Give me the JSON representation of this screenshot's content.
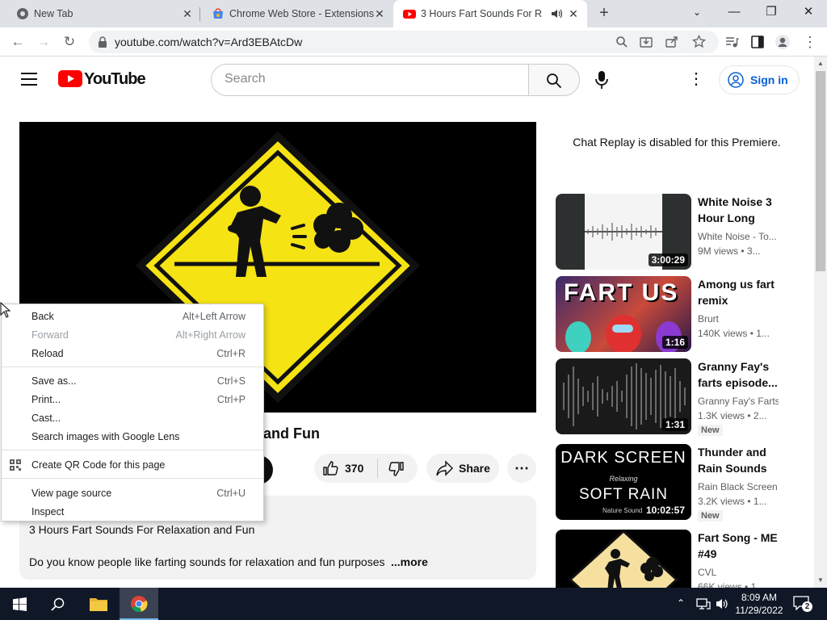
{
  "tabs": [
    {
      "title": "New Tab",
      "icon": "chrome-icon"
    },
    {
      "title": "Chrome Web Store - Extensions",
      "icon": "web-store-icon"
    },
    {
      "title": "3 Hours Fart Sounds For Rela",
      "icon": "youtube-icon",
      "active": true
    }
  ],
  "toolbar": {
    "url": "youtube.com/watch?v=Ard3EBAtcDw"
  },
  "yt": {
    "logo_text": "YouTube",
    "search_placeholder": "Search",
    "sign_in": "Sign in",
    "video_title_visible": "and Fun",
    "likes": "370",
    "share": "Share",
    "desc_title": "3 Hours Fart Sounds For Relaxation and Fun",
    "desc_text": "Do you know people like farting sounds for relaxation and fun purposes.",
    "more": "...more",
    "chat_note": "Chat Replay is disabled for this Premiere."
  },
  "recommendations": [
    {
      "title": "White Noise 3 Hour Long",
      "channel": "White Noise - To...",
      "views": "9M views",
      "age": "• 3...",
      "duration": "3:00:29",
      "badge": ""
    },
    {
      "title": "Among us fart remix",
      "channel": "Brurt",
      "views": "140K views",
      "age": "• 1...",
      "duration": "1:16",
      "badge": "",
      "thumb_text": "FART US"
    },
    {
      "title": "Granny Fay's farts episode...",
      "channel": "Granny Fay's Farts",
      "views": "1.3K views",
      "age": "• 2...",
      "duration": "1:31",
      "badge": "New"
    },
    {
      "title": "Thunder and Rain Sounds f...",
      "channel": "Rain Black Screen",
      "views": "3.2K views",
      "age": "• 1...",
      "duration": "10:02:57",
      "badge": "New",
      "thumb_lines": [
        "DARK SCREEN",
        "Relaxing",
        "SOFT RAIN",
        "Nature Sound"
      ]
    },
    {
      "title": "Fart Song - ME #49",
      "channel": "CVL",
      "views": "66K views",
      "age": "• 1",
      "duration": "",
      "badge": ""
    }
  ],
  "context_menu": [
    {
      "label": "Back",
      "shortcut": "Alt+Left Arrow",
      "disabled": false
    },
    {
      "label": "Forward",
      "shortcut": "Alt+Right Arrow",
      "disabled": true
    },
    {
      "label": "Reload",
      "shortcut": "Ctrl+R",
      "disabled": false
    },
    {
      "label": "Save as...",
      "shortcut": "Ctrl+S",
      "disabled": false
    },
    {
      "label": "Print...",
      "shortcut": "Ctrl+P",
      "disabled": false
    },
    {
      "label": "Cast...",
      "shortcut": "",
      "disabled": false
    },
    {
      "label": "Search images with Google Lens",
      "shortcut": "",
      "disabled": false
    },
    {
      "label": "Create QR Code for this page",
      "shortcut": "",
      "disabled": false
    },
    {
      "label": "View page source",
      "shortcut": "Ctrl+U",
      "disabled": false
    },
    {
      "label": "Inspect",
      "shortcut": "",
      "disabled": false
    }
  ],
  "taskbar": {
    "time": "8:09 AM",
    "date": "11/29/2022",
    "notifications": "2"
  },
  "colors": {
    "youtube_red": "#ff0000",
    "link_blue": "#065fd4",
    "sign_yellow": "#f5e314",
    "taskbar": "#101828"
  }
}
